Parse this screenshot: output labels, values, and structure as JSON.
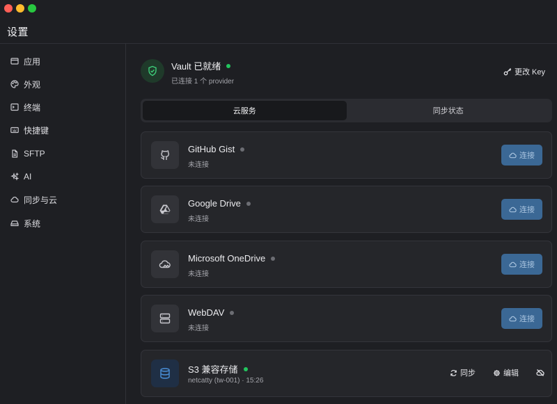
{
  "window": {
    "title": "设置"
  },
  "sidebar": {
    "items": [
      {
        "label": "应用",
        "icon": "app-window-icon"
      },
      {
        "label": "外观",
        "icon": "palette-icon"
      },
      {
        "label": "终端",
        "icon": "terminal-icon"
      },
      {
        "label": "快捷键",
        "icon": "keyboard-icon"
      },
      {
        "label": "SFTP",
        "icon": "file-icon"
      },
      {
        "label": "AI",
        "icon": "sparkles-icon"
      },
      {
        "label": "同步与云",
        "icon": "cloud-icon",
        "active": true
      },
      {
        "label": "系统",
        "icon": "drive-icon"
      }
    ]
  },
  "vault": {
    "title": "Vault 已就绪",
    "subtitle": "已连接 1 个 provider",
    "change_key_label": "更改 Key",
    "status_color": "#22c55e"
  },
  "tabs": [
    {
      "label": "云服务",
      "active": true
    },
    {
      "label": "同步状态",
      "active": false
    }
  ],
  "providers": [
    {
      "name": "GitHub Gist",
      "status": "未连接",
      "button": "连接",
      "icon": "github-icon"
    },
    {
      "name": "Google Drive",
      "status": "未连接",
      "button": "连接",
      "icon": "google-drive-icon"
    },
    {
      "name": "Microsoft OneDrive",
      "status": "未连接",
      "button": "连接",
      "icon": "onedrive-cloud-icon"
    },
    {
      "name": "WebDAV",
      "status": "未连接",
      "button": "连接",
      "icon": "server-icon"
    }
  ],
  "s3": {
    "name": "S3 兼容存储",
    "account": "netcatty (tw-001)",
    "time": "· 15:26",
    "sync_label": "同步",
    "edit_label": "编辑",
    "icon": "database-icon"
  },
  "colors": {
    "accent": "#3b6895",
    "connected": "#22c55e",
    "disconnected": "#6c6d73"
  }
}
